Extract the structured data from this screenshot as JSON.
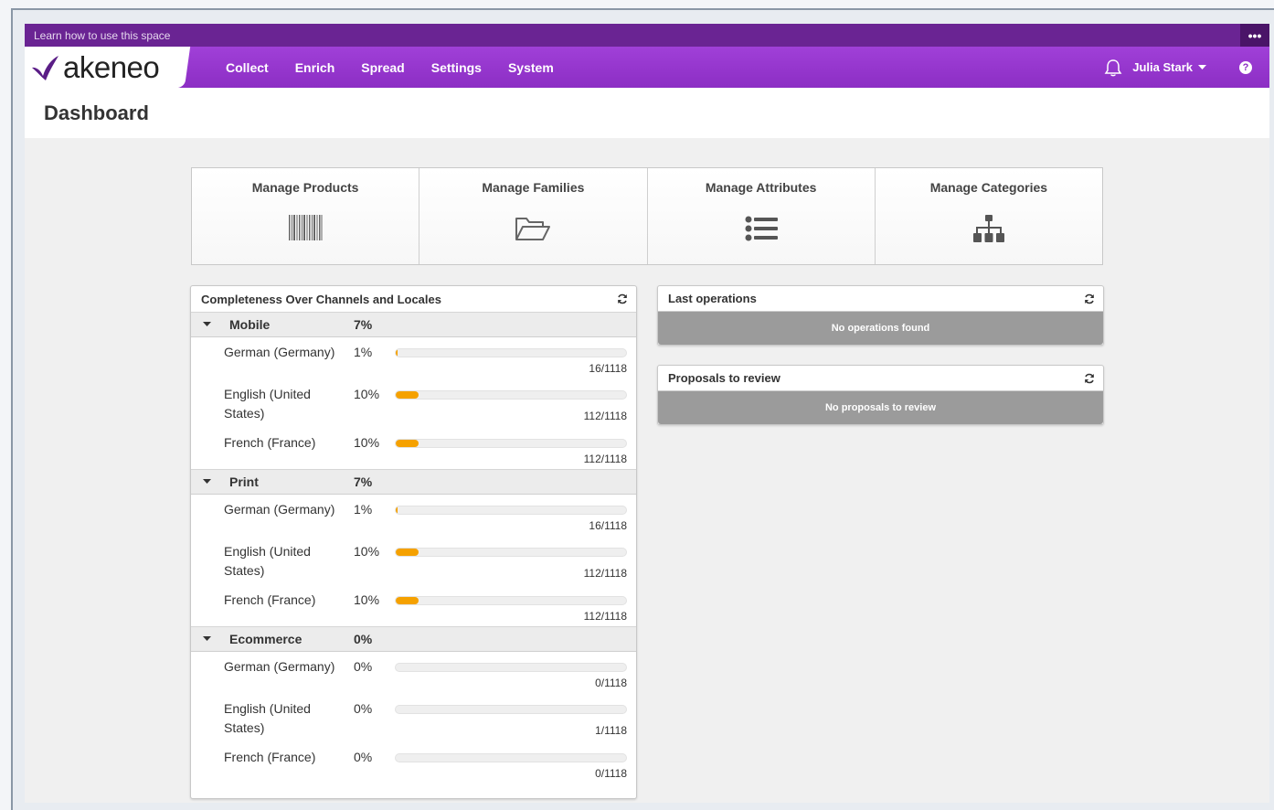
{
  "learnbar": {
    "text": "Learn how to use this space",
    "more": "•••"
  },
  "brand": {
    "name": "akeneo"
  },
  "nav": {
    "items": [
      "Collect",
      "Enrich",
      "Spread",
      "Settings",
      "System"
    ]
  },
  "user": {
    "name": "Julia Stark",
    "help": "?"
  },
  "page": {
    "title": "Dashboard"
  },
  "shortcuts": [
    {
      "label": "Manage Products",
      "icon": "barcode-icon"
    },
    {
      "label": "Manage Families",
      "icon": "folder-open-icon"
    },
    {
      "label": "Manage Attributes",
      "icon": "list-icon"
    },
    {
      "label": "Manage Categories",
      "icon": "sitemap-icon"
    }
  ],
  "completeness": {
    "title": "Completeness Over Channels and Locales",
    "channels": [
      {
        "name": "Mobile",
        "percent": "7%",
        "locales": [
          {
            "name": "German (Germany)",
            "percent": "1%",
            "ratio": "16/1118",
            "fill": 1
          },
          {
            "name": "English (United States)",
            "percent": "10%",
            "ratio": "112/1118",
            "fill": 10
          },
          {
            "name": "French (France)",
            "percent": "10%",
            "ratio": "112/1118",
            "fill": 10
          }
        ]
      },
      {
        "name": "Print",
        "percent": "7%",
        "locales": [
          {
            "name": "German (Germany)",
            "percent": "1%",
            "ratio": "16/1118",
            "fill": 1
          },
          {
            "name": "English (United States)",
            "percent": "10%",
            "ratio": "112/1118",
            "fill": 10
          },
          {
            "name": "French (France)",
            "percent": "10%",
            "ratio": "112/1118",
            "fill": 10
          }
        ]
      },
      {
        "name": "Ecommerce",
        "percent": "0%",
        "locales": [
          {
            "name": "German (Germany)",
            "percent": "0%",
            "ratio": "0/1118",
            "fill": 0
          },
          {
            "name": "English (United States)",
            "percent": "0%",
            "ratio": "1/1118",
            "fill": 0
          },
          {
            "name": "French (France)",
            "percent": "0%",
            "ratio": "0/1118",
            "fill": 0
          }
        ]
      }
    ]
  },
  "last_operations": {
    "title": "Last operations",
    "empty": "No operations found"
  },
  "proposals": {
    "title": "Proposals to review",
    "empty": "No proposals to review"
  },
  "colors": {
    "brand_purple": "#8c2ec4",
    "learnbar": "#6a2493",
    "progress": "#f5a100"
  }
}
